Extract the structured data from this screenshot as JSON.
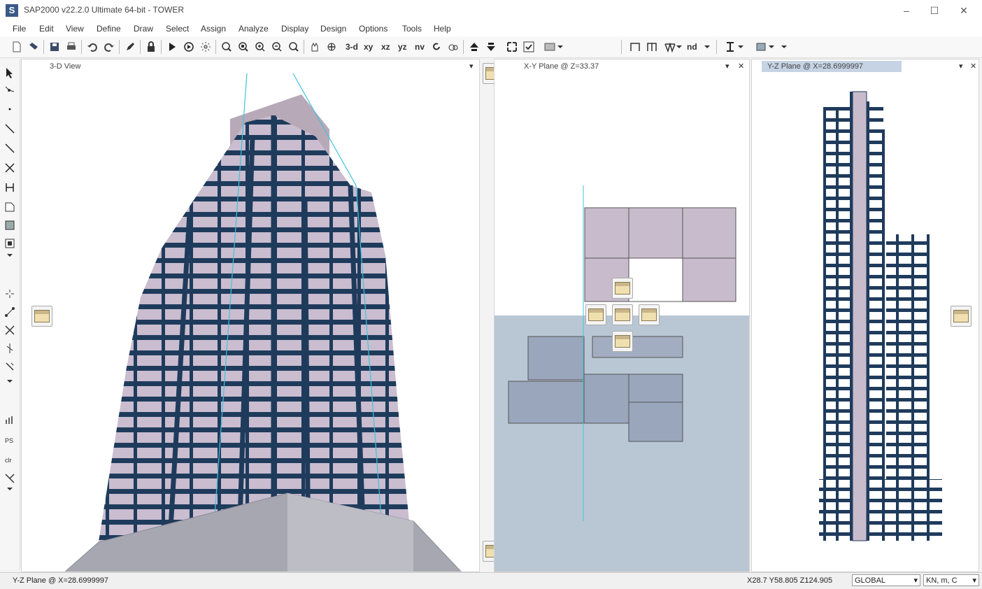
{
  "window": {
    "title": "SAP2000 v22.2.0 Ultimate 64-bit - TOWER",
    "icon_letter": "S",
    "minimize_glyph": "–",
    "maximize_glyph": "☐",
    "close_glyph": "✕"
  },
  "menu": [
    "File",
    "Edit",
    "View",
    "Define",
    "Draw",
    "Select",
    "Assign",
    "Analyze",
    "Display",
    "Design",
    "Options",
    "Tools",
    "Help"
  ],
  "toolbar": {
    "view_3d": "3-d",
    "view_xy": "xy",
    "view_xz": "xz",
    "view_yz": "yz",
    "view_nv": "nv",
    "nd": "nd"
  },
  "panels": {
    "left_title": "3-D View",
    "middle_title": "X-Y Plane @ Z=33.37",
    "right_title": "Y-Z Plane @ X=28.6999997",
    "dropdown_glyph": "▾",
    "close_glyph": "✕"
  },
  "statusbar": {
    "left_text": "Y-Z Plane @ X=28.6999997",
    "coords": "X28.7  Y58.805  Z124.905",
    "coord_system": "GLOBAL",
    "units": "KN, m, C"
  },
  "colors": {
    "frame": "#1f3b5c",
    "slab": "#c8bccc",
    "background": "#ffffff",
    "selection_fill": "#9aafc6"
  }
}
